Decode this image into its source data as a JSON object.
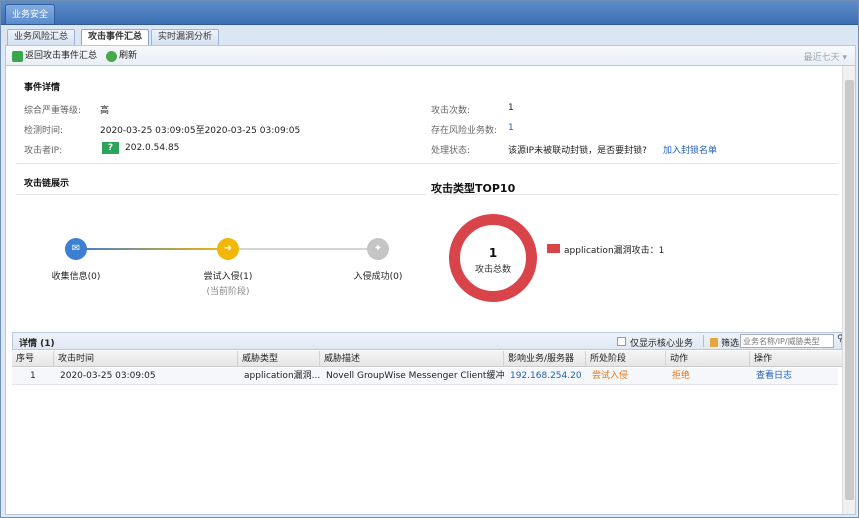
{
  "window": {
    "top_tab": "业务安全"
  },
  "subtabs": [
    "业务风险汇总",
    "攻击事件汇总",
    "实时漏洞分析"
  ],
  "toolbar": {
    "back_label": "返回攻击事件汇总",
    "refresh_label": "刷新",
    "range_label": "最近七天"
  },
  "event": {
    "section_title": "事件详情",
    "severity_label": "综合严重等级:",
    "severity_value": "高",
    "time_label": "检测时间:",
    "time_value": "2020-03-25 03:09:05至2020-03-25 03:09:05",
    "ip_label": "攻击者IP:",
    "ip_badge": "?",
    "ip_value": "202.0.54.85",
    "count_label": "攻击次数:",
    "count_value": "1",
    "risk_label": "存在风险业务数:",
    "risk_value": "1",
    "status_label": "处理状态:",
    "status_value": "该源IP未被联动封锁，是否要封锁?",
    "block_link": "加入封锁名单"
  },
  "chain": {
    "section_title": "攻击链展示",
    "nodes": [
      {
        "label": "收集信息(0)",
        "sub": "",
        "color": "#3d7fd1"
      },
      {
        "label": "尝试入侵(1)",
        "sub": "(当前阶段)",
        "color": "#f2b705"
      },
      {
        "label": "入侵成功(0)",
        "sub": "",
        "color": "#c5c5c5"
      }
    ]
  },
  "top10": {
    "title": "攻击类型TOP10",
    "total": "1",
    "total_caption": "攻击总数",
    "legend": "application漏洞攻击：1",
    "color": "#d9434a"
  },
  "details": {
    "title": "详情 (1)",
    "core_only": "仅显示核心业务",
    "filter_label": "筛选",
    "search_placeholder": "业务名称/IP/威胁类型",
    "columns": [
      "序号",
      "攻击时间",
      "威胁类型",
      "威胁描述",
      "影响业务/服务器",
      "所处阶段",
      "动作",
      "操作"
    ],
    "rows": [
      [
        "1",
        "2020-03-25 03:09:05",
        "application漏洞...",
        "Novell GroupWise Messenger Client缓冲...",
        "192.168.254.20",
        "尝试入侵",
        "拒绝",
        "查看日志"
      ]
    ]
  }
}
